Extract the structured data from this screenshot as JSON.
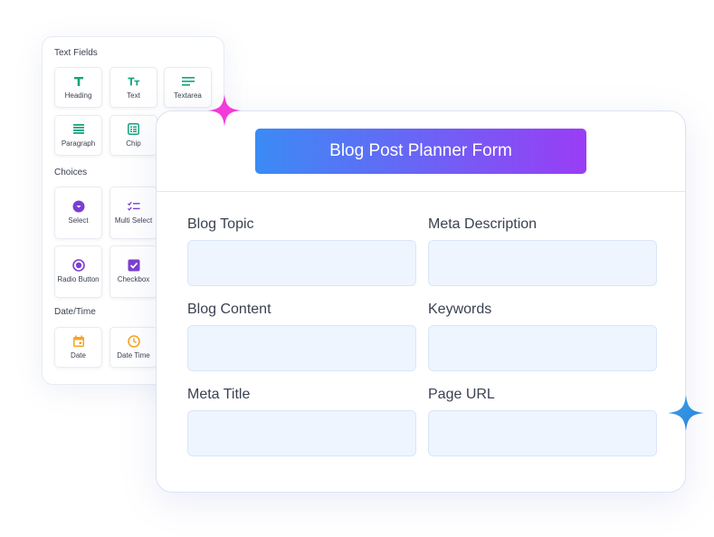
{
  "palette": {
    "sections": {
      "text_fields": "Text Fields",
      "choices": "Choices",
      "date_time": "Date/Time"
    },
    "items": {
      "heading": "Heading",
      "text": "Text",
      "textarea": "Textarea",
      "paragraph": "Paragraph",
      "chip": "Chip",
      "select": "Select",
      "multi_select": "Multi Select",
      "radio_button": "Radio Button",
      "checkbox": "Checkbox",
      "date": "Date",
      "date_time": "Date Time"
    },
    "icons": {
      "heading": "heading-icon",
      "text": "text-size-icon",
      "textarea": "textarea-lines-icon",
      "paragraph": "paragraph-icon",
      "chip": "chip-list-icon",
      "select": "dropdown-circle-icon",
      "multi_select": "multi-check-icon",
      "radio_button": "radio-icon",
      "checkbox": "checkbox-icon",
      "date": "calendar-icon",
      "date_time": "clock-icon"
    }
  },
  "form": {
    "title": "Blog Post Planner Form",
    "fields": {
      "blog_topic": "Blog Topic",
      "meta_description": "Meta Description",
      "blog_content": "Blog Content",
      "keywords": "Keywords",
      "meta_title": "Meta Title",
      "page_url": "Page URL"
    }
  },
  "colors": {
    "teal": "#14a37f",
    "purple": "#7b3fd0",
    "orange": "#f5a623",
    "gradient_start": "#3b8bf5",
    "gradient_end": "#9a3df5",
    "sparkle_pink": "#f23bd9",
    "sparkle_blue": "#3aa2e8"
  }
}
